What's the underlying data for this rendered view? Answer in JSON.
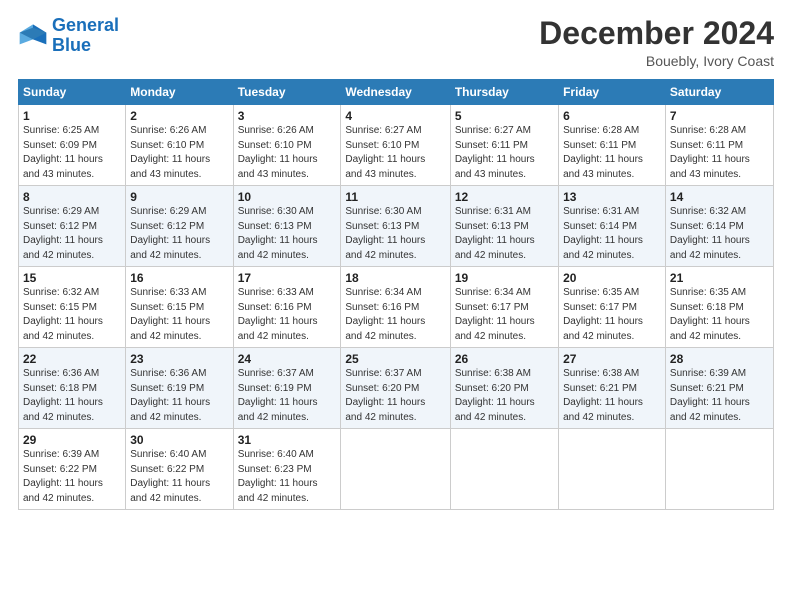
{
  "logo": {
    "line1": "General",
    "line2": "Blue"
  },
  "title": "December 2024",
  "subtitle": "Bouebly, Ivory Coast",
  "days_of_week": [
    "Sunday",
    "Monday",
    "Tuesday",
    "Wednesday",
    "Thursday",
    "Friday",
    "Saturday"
  ],
  "weeks": [
    [
      {
        "day": "1",
        "info": "Sunrise: 6:25 AM\nSunset: 6:09 PM\nDaylight: 11 hours\nand 43 minutes."
      },
      {
        "day": "2",
        "info": "Sunrise: 6:26 AM\nSunset: 6:10 PM\nDaylight: 11 hours\nand 43 minutes."
      },
      {
        "day": "3",
        "info": "Sunrise: 6:26 AM\nSunset: 6:10 PM\nDaylight: 11 hours\nand 43 minutes."
      },
      {
        "day": "4",
        "info": "Sunrise: 6:27 AM\nSunset: 6:10 PM\nDaylight: 11 hours\nand 43 minutes."
      },
      {
        "day": "5",
        "info": "Sunrise: 6:27 AM\nSunset: 6:11 PM\nDaylight: 11 hours\nand 43 minutes."
      },
      {
        "day": "6",
        "info": "Sunrise: 6:28 AM\nSunset: 6:11 PM\nDaylight: 11 hours\nand 43 minutes."
      },
      {
        "day": "7",
        "info": "Sunrise: 6:28 AM\nSunset: 6:11 PM\nDaylight: 11 hours\nand 43 minutes."
      }
    ],
    [
      {
        "day": "8",
        "info": "Sunrise: 6:29 AM\nSunset: 6:12 PM\nDaylight: 11 hours\nand 42 minutes."
      },
      {
        "day": "9",
        "info": "Sunrise: 6:29 AM\nSunset: 6:12 PM\nDaylight: 11 hours\nand 42 minutes."
      },
      {
        "day": "10",
        "info": "Sunrise: 6:30 AM\nSunset: 6:13 PM\nDaylight: 11 hours\nand 42 minutes."
      },
      {
        "day": "11",
        "info": "Sunrise: 6:30 AM\nSunset: 6:13 PM\nDaylight: 11 hours\nand 42 minutes."
      },
      {
        "day": "12",
        "info": "Sunrise: 6:31 AM\nSunset: 6:13 PM\nDaylight: 11 hours\nand 42 minutes."
      },
      {
        "day": "13",
        "info": "Sunrise: 6:31 AM\nSunset: 6:14 PM\nDaylight: 11 hours\nand 42 minutes."
      },
      {
        "day": "14",
        "info": "Sunrise: 6:32 AM\nSunset: 6:14 PM\nDaylight: 11 hours\nand 42 minutes."
      }
    ],
    [
      {
        "day": "15",
        "info": "Sunrise: 6:32 AM\nSunset: 6:15 PM\nDaylight: 11 hours\nand 42 minutes."
      },
      {
        "day": "16",
        "info": "Sunrise: 6:33 AM\nSunset: 6:15 PM\nDaylight: 11 hours\nand 42 minutes."
      },
      {
        "day": "17",
        "info": "Sunrise: 6:33 AM\nSunset: 6:16 PM\nDaylight: 11 hours\nand 42 minutes."
      },
      {
        "day": "18",
        "info": "Sunrise: 6:34 AM\nSunset: 6:16 PM\nDaylight: 11 hours\nand 42 minutes."
      },
      {
        "day": "19",
        "info": "Sunrise: 6:34 AM\nSunset: 6:17 PM\nDaylight: 11 hours\nand 42 minutes."
      },
      {
        "day": "20",
        "info": "Sunrise: 6:35 AM\nSunset: 6:17 PM\nDaylight: 11 hours\nand 42 minutes."
      },
      {
        "day": "21",
        "info": "Sunrise: 6:35 AM\nSunset: 6:18 PM\nDaylight: 11 hours\nand 42 minutes."
      }
    ],
    [
      {
        "day": "22",
        "info": "Sunrise: 6:36 AM\nSunset: 6:18 PM\nDaylight: 11 hours\nand 42 minutes."
      },
      {
        "day": "23",
        "info": "Sunrise: 6:36 AM\nSunset: 6:19 PM\nDaylight: 11 hours\nand 42 minutes."
      },
      {
        "day": "24",
        "info": "Sunrise: 6:37 AM\nSunset: 6:19 PM\nDaylight: 11 hours\nand 42 minutes."
      },
      {
        "day": "25",
        "info": "Sunrise: 6:37 AM\nSunset: 6:20 PM\nDaylight: 11 hours\nand 42 minutes."
      },
      {
        "day": "26",
        "info": "Sunrise: 6:38 AM\nSunset: 6:20 PM\nDaylight: 11 hours\nand 42 minutes."
      },
      {
        "day": "27",
        "info": "Sunrise: 6:38 AM\nSunset: 6:21 PM\nDaylight: 11 hours\nand 42 minutes."
      },
      {
        "day": "28",
        "info": "Sunrise: 6:39 AM\nSunset: 6:21 PM\nDaylight: 11 hours\nand 42 minutes."
      }
    ],
    [
      {
        "day": "29",
        "info": "Sunrise: 6:39 AM\nSunset: 6:22 PM\nDaylight: 11 hours\nand 42 minutes."
      },
      {
        "day": "30",
        "info": "Sunrise: 6:40 AM\nSunset: 6:22 PM\nDaylight: 11 hours\nand 42 minutes."
      },
      {
        "day": "31",
        "info": "Sunrise: 6:40 AM\nSunset: 6:23 PM\nDaylight: 11 hours\nand 42 minutes."
      },
      {
        "day": "",
        "info": ""
      },
      {
        "day": "",
        "info": ""
      },
      {
        "day": "",
        "info": ""
      },
      {
        "day": "",
        "info": ""
      }
    ]
  ]
}
